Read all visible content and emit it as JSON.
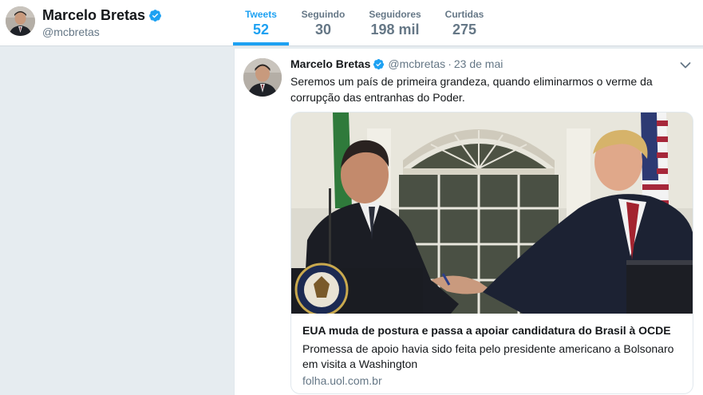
{
  "profile": {
    "name": "Marcelo Bretas",
    "handle": "@mcbretas"
  },
  "stats": [
    {
      "label": "Tweets",
      "value": "52",
      "active": true
    },
    {
      "label": "Seguindo",
      "value": "30",
      "active": false
    },
    {
      "label": "Seguidores",
      "value": "198 mil",
      "active": false
    },
    {
      "label": "Curtidas",
      "value": "275",
      "active": false
    }
  ],
  "tweet": {
    "name": "Marcelo Bretas",
    "handle": "@mcbretas",
    "separator": "·",
    "date": "23 de mai",
    "text": "Seremos um país de primeira grandeza, quando eliminarmos o verme da corrupção das entranhas do Poder.",
    "card": {
      "title": "EUA muda de postura e passa a apoiar candidatura do Brasil à OCDE",
      "description": "Promessa de apoio havia sido feita pelo presidente americano a Bolsonaro em visita a Washington",
      "domain": "folha.uol.com.br"
    }
  },
  "colors": {
    "accent": "#1da1f2",
    "background": "#e6ecf0",
    "muted_text": "#657786"
  },
  "icons": [
    "verified-badge-icon",
    "chevron-down-icon"
  ]
}
